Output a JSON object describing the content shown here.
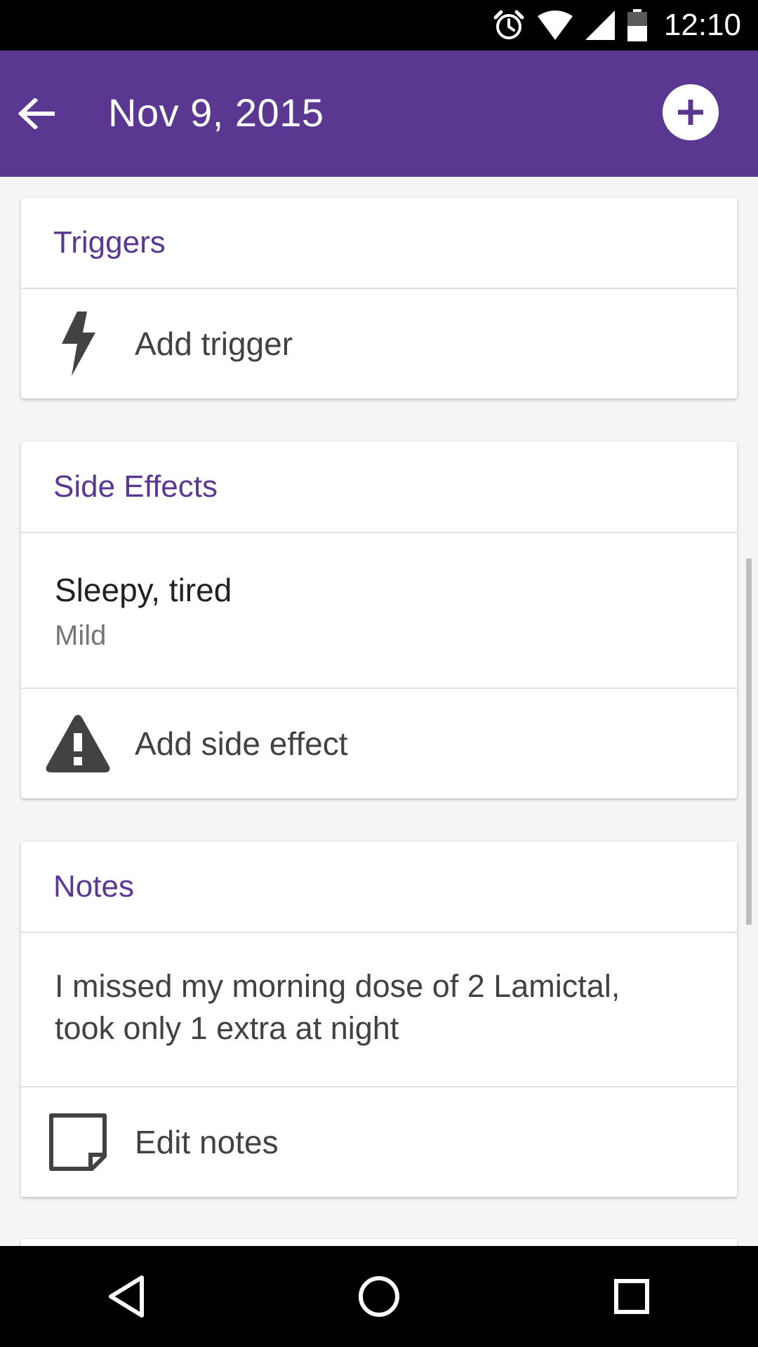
{
  "status_bar": {
    "time": "12:10",
    "icons": [
      "alarm-icon",
      "wifi-icon",
      "signal-icon",
      "battery-icon"
    ]
  },
  "app_bar": {
    "title": "Nov 9, 2015",
    "back_icon": "arrow-back-icon",
    "add_icon": "add-circle-icon",
    "color": "#5a3892"
  },
  "triggers_card": {
    "header": "Triggers",
    "add_label": "Add trigger",
    "add_icon": "lightning-icon"
  },
  "side_effects_card": {
    "header": "Side Effects",
    "items": [
      {
        "name": "Sleepy, tired",
        "severity": "Mild"
      }
    ],
    "add_label": "Add side effect",
    "add_icon": "warning-icon"
  },
  "notes_card": {
    "header": "Notes",
    "text_line_1": "I missed my morning dose of 2 Lamictal,",
    "text_line_2": "took only 1 extra at night",
    "edit_label": "Edit notes",
    "edit_icon": "note-icon"
  },
  "nav_bar": {
    "icons": [
      "back-triangle-icon",
      "home-circle-icon",
      "recents-square-icon"
    ]
  }
}
